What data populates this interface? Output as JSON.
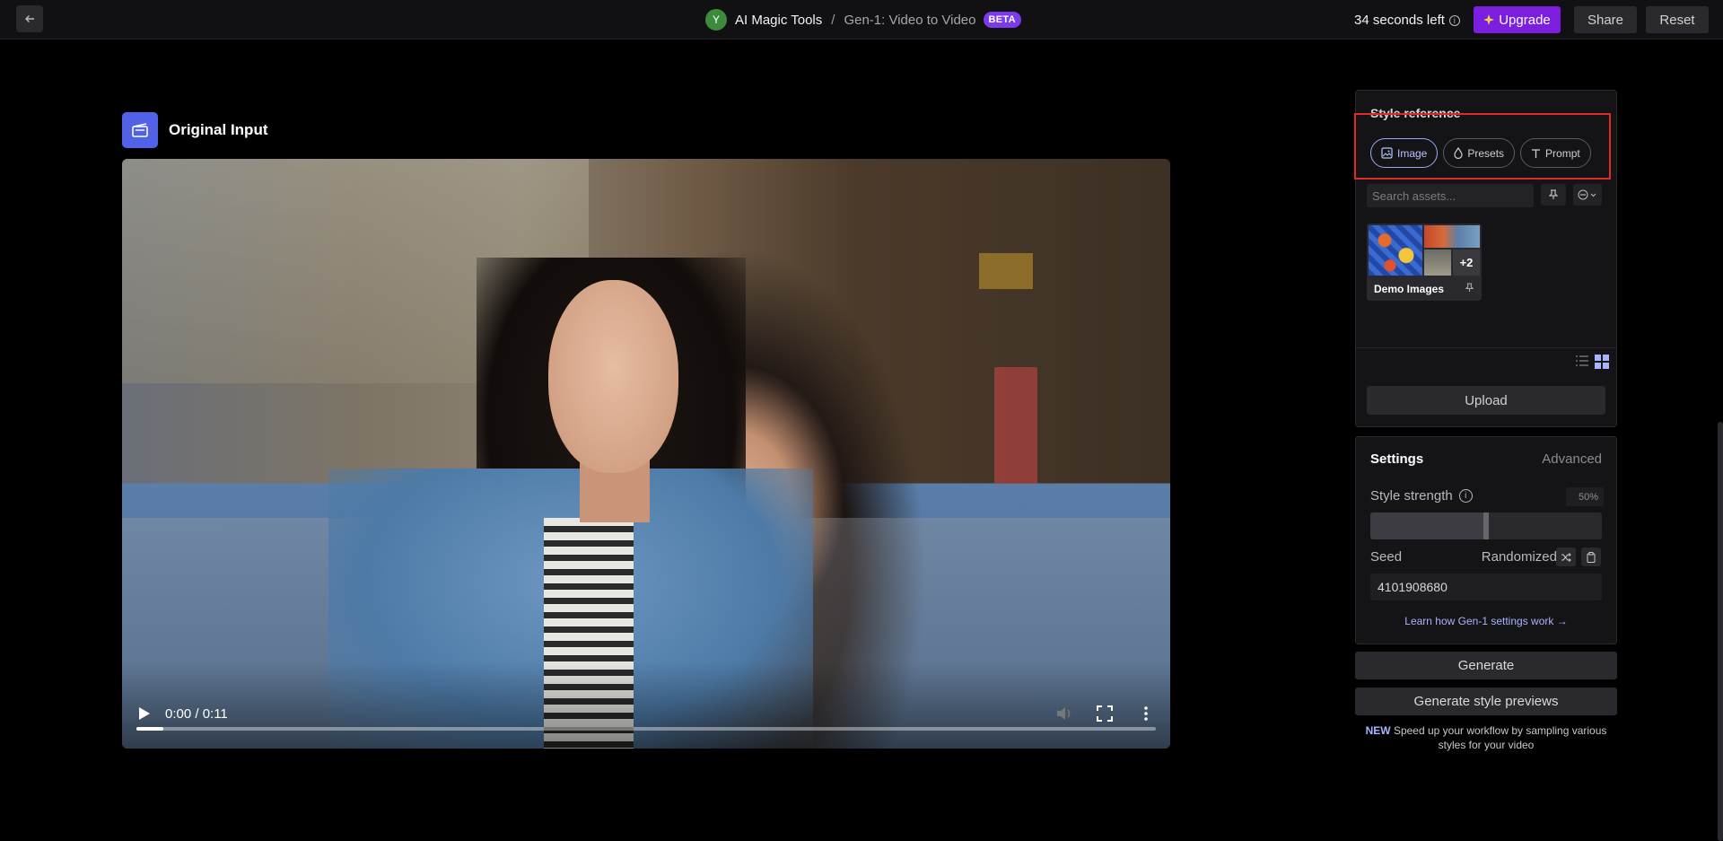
{
  "topbar": {
    "avatar_letter": "Y",
    "app_name": "AI Magic Tools",
    "separator": "/",
    "page_name": "Gen-1: Video to Video",
    "badge": "BETA",
    "time_left": "34 seconds left",
    "upgrade_label": "Upgrade",
    "share_label": "Share",
    "reset_label": "Reset"
  },
  "input": {
    "title": "Original Input"
  },
  "video": {
    "time": "0:00 / 0:11",
    "progress": 0.0
  },
  "style_reference": {
    "title": "Style reference",
    "tabs": [
      {
        "label": "Image",
        "icon": "image-icon",
        "active": true
      },
      {
        "label": "Presets",
        "icon": "drop-icon",
        "active": false
      },
      {
        "label": "Prompt",
        "icon": "text-icon",
        "active": false
      }
    ],
    "search_placeholder": "Search assets...",
    "folder": {
      "name": "Demo Images",
      "extra_count": "+2"
    },
    "upload_label": "Upload"
  },
  "settings": {
    "title": "Settings",
    "advanced_label": "Advanced",
    "style_strength_label": "Style strength",
    "style_strength_value": "50%",
    "style_strength_fraction": 0.5,
    "seed_label": "Seed",
    "seed_mode": "Randomized",
    "seed_value": "4101908680",
    "learn_link": "Learn how Gen-1 settings work"
  },
  "actions": {
    "generate_label": "Generate",
    "generate_previews_label": "Generate style previews",
    "new_tag": "NEW",
    "new_note": "Speed up your workflow by sampling various styles for your video"
  },
  "colors": {
    "accent": "#7c1ee0",
    "link": "#a9b4ff",
    "highlight": "#e02a25",
    "input_icon_bg": "#5162e8"
  }
}
